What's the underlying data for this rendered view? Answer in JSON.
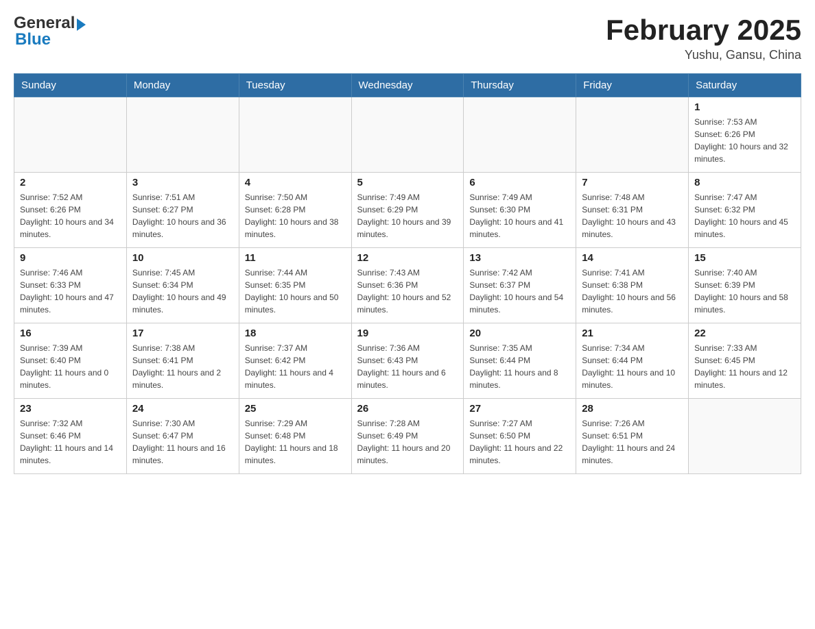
{
  "header": {
    "logo_general": "General",
    "logo_blue": "Blue",
    "title": "February 2025",
    "location": "Yushu, Gansu, China"
  },
  "weekdays": [
    "Sunday",
    "Monday",
    "Tuesday",
    "Wednesday",
    "Thursday",
    "Friday",
    "Saturday"
  ],
  "weeks": [
    [
      {
        "day": "",
        "sunrise": "",
        "sunset": "",
        "daylight": ""
      },
      {
        "day": "",
        "sunrise": "",
        "sunset": "",
        "daylight": ""
      },
      {
        "day": "",
        "sunrise": "",
        "sunset": "",
        "daylight": ""
      },
      {
        "day": "",
        "sunrise": "",
        "sunset": "",
        "daylight": ""
      },
      {
        "day": "",
        "sunrise": "",
        "sunset": "",
        "daylight": ""
      },
      {
        "day": "",
        "sunrise": "",
        "sunset": "",
        "daylight": ""
      },
      {
        "day": "1",
        "sunrise": "Sunrise: 7:53 AM",
        "sunset": "Sunset: 6:26 PM",
        "daylight": "Daylight: 10 hours and 32 minutes."
      }
    ],
    [
      {
        "day": "2",
        "sunrise": "Sunrise: 7:52 AM",
        "sunset": "Sunset: 6:26 PM",
        "daylight": "Daylight: 10 hours and 34 minutes."
      },
      {
        "day": "3",
        "sunrise": "Sunrise: 7:51 AM",
        "sunset": "Sunset: 6:27 PM",
        "daylight": "Daylight: 10 hours and 36 minutes."
      },
      {
        "day": "4",
        "sunrise": "Sunrise: 7:50 AM",
        "sunset": "Sunset: 6:28 PM",
        "daylight": "Daylight: 10 hours and 38 minutes."
      },
      {
        "day": "5",
        "sunrise": "Sunrise: 7:49 AM",
        "sunset": "Sunset: 6:29 PM",
        "daylight": "Daylight: 10 hours and 39 minutes."
      },
      {
        "day": "6",
        "sunrise": "Sunrise: 7:49 AM",
        "sunset": "Sunset: 6:30 PM",
        "daylight": "Daylight: 10 hours and 41 minutes."
      },
      {
        "day": "7",
        "sunrise": "Sunrise: 7:48 AM",
        "sunset": "Sunset: 6:31 PM",
        "daylight": "Daylight: 10 hours and 43 minutes."
      },
      {
        "day": "8",
        "sunrise": "Sunrise: 7:47 AM",
        "sunset": "Sunset: 6:32 PM",
        "daylight": "Daylight: 10 hours and 45 minutes."
      }
    ],
    [
      {
        "day": "9",
        "sunrise": "Sunrise: 7:46 AM",
        "sunset": "Sunset: 6:33 PM",
        "daylight": "Daylight: 10 hours and 47 minutes."
      },
      {
        "day": "10",
        "sunrise": "Sunrise: 7:45 AM",
        "sunset": "Sunset: 6:34 PM",
        "daylight": "Daylight: 10 hours and 49 minutes."
      },
      {
        "day": "11",
        "sunrise": "Sunrise: 7:44 AM",
        "sunset": "Sunset: 6:35 PM",
        "daylight": "Daylight: 10 hours and 50 minutes."
      },
      {
        "day": "12",
        "sunrise": "Sunrise: 7:43 AM",
        "sunset": "Sunset: 6:36 PM",
        "daylight": "Daylight: 10 hours and 52 minutes."
      },
      {
        "day": "13",
        "sunrise": "Sunrise: 7:42 AM",
        "sunset": "Sunset: 6:37 PM",
        "daylight": "Daylight: 10 hours and 54 minutes."
      },
      {
        "day": "14",
        "sunrise": "Sunrise: 7:41 AM",
        "sunset": "Sunset: 6:38 PM",
        "daylight": "Daylight: 10 hours and 56 minutes."
      },
      {
        "day": "15",
        "sunrise": "Sunrise: 7:40 AM",
        "sunset": "Sunset: 6:39 PM",
        "daylight": "Daylight: 10 hours and 58 minutes."
      }
    ],
    [
      {
        "day": "16",
        "sunrise": "Sunrise: 7:39 AM",
        "sunset": "Sunset: 6:40 PM",
        "daylight": "Daylight: 11 hours and 0 minutes."
      },
      {
        "day": "17",
        "sunrise": "Sunrise: 7:38 AM",
        "sunset": "Sunset: 6:41 PM",
        "daylight": "Daylight: 11 hours and 2 minutes."
      },
      {
        "day": "18",
        "sunrise": "Sunrise: 7:37 AM",
        "sunset": "Sunset: 6:42 PM",
        "daylight": "Daylight: 11 hours and 4 minutes."
      },
      {
        "day": "19",
        "sunrise": "Sunrise: 7:36 AM",
        "sunset": "Sunset: 6:43 PM",
        "daylight": "Daylight: 11 hours and 6 minutes."
      },
      {
        "day": "20",
        "sunrise": "Sunrise: 7:35 AM",
        "sunset": "Sunset: 6:44 PM",
        "daylight": "Daylight: 11 hours and 8 minutes."
      },
      {
        "day": "21",
        "sunrise": "Sunrise: 7:34 AM",
        "sunset": "Sunset: 6:44 PM",
        "daylight": "Daylight: 11 hours and 10 minutes."
      },
      {
        "day": "22",
        "sunrise": "Sunrise: 7:33 AM",
        "sunset": "Sunset: 6:45 PM",
        "daylight": "Daylight: 11 hours and 12 minutes."
      }
    ],
    [
      {
        "day": "23",
        "sunrise": "Sunrise: 7:32 AM",
        "sunset": "Sunset: 6:46 PM",
        "daylight": "Daylight: 11 hours and 14 minutes."
      },
      {
        "day": "24",
        "sunrise": "Sunrise: 7:30 AM",
        "sunset": "Sunset: 6:47 PM",
        "daylight": "Daylight: 11 hours and 16 minutes."
      },
      {
        "day": "25",
        "sunrise": "Sunrise: 7:29 AM",
        "sunset": "Sunset: 6:48 PM",
        "daylight": "Daylight: 11 hours and 18 minutes."
      },
      {
        "day": "26",
        "sunrise": "Sunrise: 7:28 AM",
        "sunset": "Sunset: 6:49 PM",
        "daylight": "Daylight: 11 hours and 20 minutes."
      },
      {
        "day": "27",
        "sunrise": "Sunrise: 7:27 AM",
        "sunset": "Sunset: 6:50 PM",
        "daylight": "Daylight: 11 hours and 22 minutes."
      },
      {
        "day": "28",
        "sunrise": "Sunrise: 7:26 AM",
        "sunset": "Sunset: 6:51 PM",
        "daylight": "Daylight: 11 hours and 24 minutes."
      },
      {
        "day": "",
        "sunrise": "",
        "sunset": "",
        "daylight": ""
      }
    ]
  ]
}
